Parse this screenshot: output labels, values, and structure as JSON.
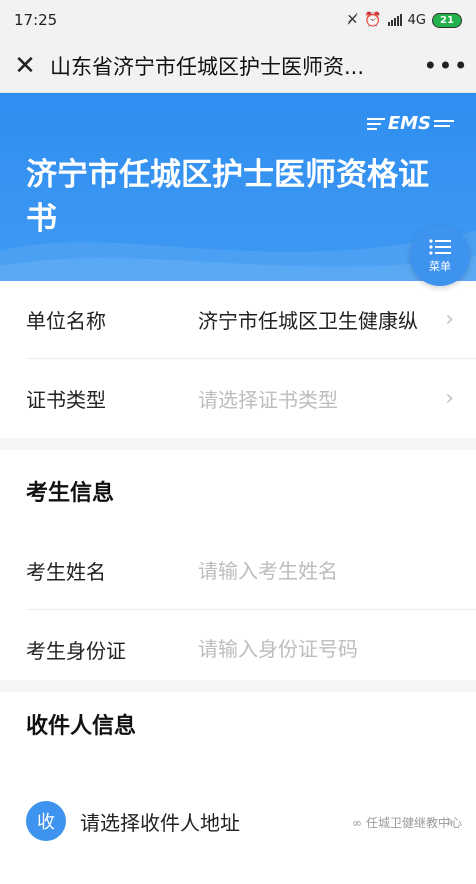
{
  "status_bar": {
    "time": "17:25",
    "network": "4G",
    "battery": "21"
  },
  "title_bar": {
    "title": "山东省济宁市任城区护士医师资..."
  },
  "banner": {
    "brand": "EMS",
    "title": "济宁市任城区护士医师资格证书"
  },
  "menu": {
    "label": "菜单"
  },
  "form": {
    "unit_label": "单位名称",
    "unit_value": "济宁市任城区卫生健康纵",
    "cert_type_label": "证书类型",
    "cert_type_placeholder": "请选择证书类型"
  },
  "examinee": {
    "heading": "考生信息",
    "name_label": "考生姓名",
    "name_placeholder": "请输入考生姓名",
    "id_label": "考生身份证",
    "id_placeholder": "请输入身份证号码"
  },
  "recipient": {
    "heading": "收件人信息",
    "badge": "收",
    "address_text": "请选择收件人地址"
  },
  "watermark": {
    "text": "任城卫健继教中心"
  },
  "colors": {
    "primary": "#3e93ee",
    "banner": "#2f8ef0",
    "placeholder": "#bdbdbd",
    "gap": "#f5f5f5"
  }
}
